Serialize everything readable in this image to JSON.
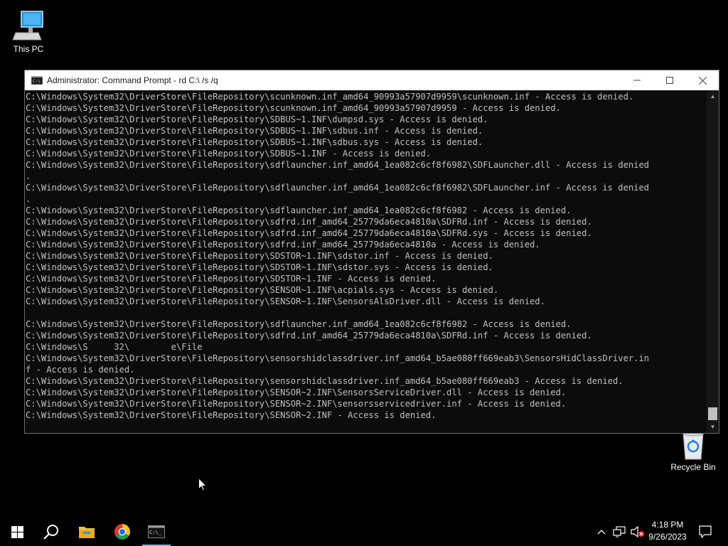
{
  "desktop": {
    "this_pc_label": "This PC",
    "recycle_bin_label": "Recycle Bin"
  },
  "window": {
    "title": "Administrator: Command Prompt - rd  C:\\ /s /q",
    "minimize_icon": "minimize-icon",
    "maximize_icon": "maximize-icon",
    "close_icon": "close-icon"
  },
  "console": {
    "lines": [
      "C:\\Windows\\System32\\DriverStore\\FileRepository\\scunknown.inf_amd64_90993a57907d9959\\scunknown.inf - Access is denied.",
      "C:\\Windows\\System32\\DriverStore\\FileRepository\\scunknown.inf_amd64_90993a57907d9959 - Access is denied.",
      "C:\\Windows\\System32\\DriverStore\\FileRepository\\SDBUS~1.INF\\dumpsd.sys - Access is denied.",
      "C:\\Windows\\System32\\DriverStore\\FileRepository\\SDBUS~1.INF\\sdbus.inf - Access is denied.",
      "C:\\Windows\\System32\\DriverStore\\FileRepository\\SDBUS~1.INF\\sdbus.sys - Access is denied.",
      "C:\\Windows\\System32\\DriverStore\\FileRepository\\SDBUS~1.INF - Access is denied.",
      "C:\\Windows\\System32\\DriverStore\\FileRepository\\sdflauncher.inf_amd64_1ea082c6cf8f6982\\SDFLauncher.dll - Access is denied",
      ".",
      "C:\\Windows\\System32\\DriverStore\\FileRepository\\sdflauncher.inf_amd64_1ea082c6cf8f6982\\SDFLauncher.inf - Access is denied",
      ".",
      "C:\\Windows\\System32\\DriverStore\\FileRepository\\sdflauncher.inf_amd64_1ea082c6cf8f6982 - Access is denied.",
      "C:\\Windows\\System32\\DriverStore\\FileRepository\\sdfrd.inf_amd64_25779da6eca4810a\\SDFRd.inf - Access is denied.",
      "C:\\Windows\\System32\\DriverStore\\FileRepository\\sdfrd.inf_amd64_25779da6eca4810a\\SDFRd.sys - Access is denied.",
      "C:\\Windows\\System32\\DriverStore\\FileRepository\\sdfrd.inf_amd64_25779da6eca4810a - Access is denied.",
      "C:\\Windows\\System32\\DriverStore\\FileRepository\\SDSTOR~1.INF\\sdstor.inf - Access is denied.",
      "C:\\Windows\\System32\\DriverStore\\FileRepository\\SDSTOR~1.INF\\sdstor.sys - Access is denied.",
      "C:\\Windows\\System32\\DriverStore\\FileRepository\\SDSTOR~1.INF - Access is denied.",
      "C:\\Windows\\System32\\DriverStore\\FileRepository\\SENSOR~1.INF\\acpials.sys - Access is denied.",
      "C:\\Windows\\System32\\DriverStore\\FileRepository\\SENSOR~1.INF\\SensorsAlsDriver.dll - Access is denied.",
      "",
      "C:\\Windows\\System32\\DriverStore\\FileRepository\\sdflauncher.inf_amd64_1ea082c6cf8f6982 - Access is denied.",
      "C:\\Windows\\System32\\DriverStore\\FileRepository\\sdfrd.inf_amd64_25779da6eca4810a\\SDFRd.inf - Access is denied.",
      "C:\\Windows\\S     32\\        e\\File",
      "C:\\Windows\\System32\\DriverStore\\FileRepository\\sensorshidclassdriver.inf_amd64_b5ae080ff669eab3\\SensorsHidClassDriver.in",
      "f - Access is denied.",
      "C:\\Windows\\System32\\DriverStore\\FileRepository\\sensorshidclassdriver.inf_amd64_b5ae080ff669eab3 - Access is denied.",
      "C:\\Windows\\System32\\DriverStore\\FileRepository\\SENSOR~2.INF\\SensorsServiceDriver.dll - Access is denied.",
      "C:\\Windows\\System32\\DriverStore\\FileRepository\\SENSOR~2.INF\\sensorsservicedriver.inf - Access is denied.",
      "C:\\Windows\\System32\\DriverStore\\FileRepository\\SENSOR~2.INF - Access is denied."
    ]
  },
  "taskbar": {
    "start_icon": "windows-start-icon",
    "search_icon": "search-icon",
    "explorer_icon": "file-explorer-icon",
    "chrome_icon": "chrome-icon",
    "cmd_icon": "command-prompt-icon",
    "accent_color": "#76b9ed"
  },
  "tray": {
    "time": "4:18 PM",
    "date": "9/26/2023"
  }
}
